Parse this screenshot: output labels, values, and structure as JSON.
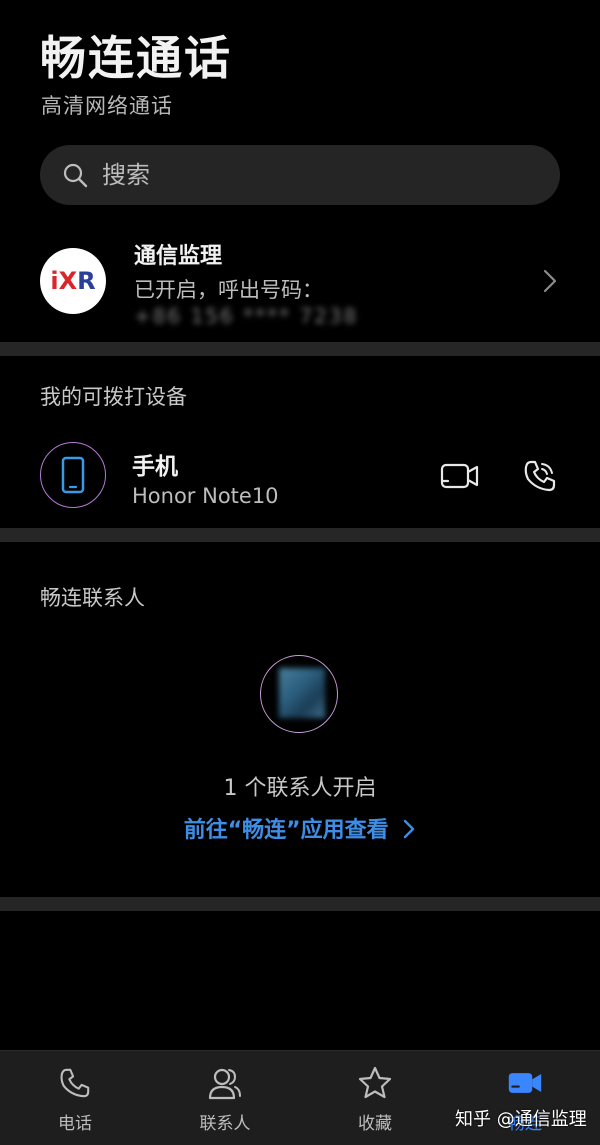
{
  "header": {
    "title": "畅连通话",
    "subtitle": "高清网络通话"
  },
  "search": {
    "placeholder": "搜索"
  },
  "account": {
    "logo_text": "iXR",
    "name": "通信监理",
    "status": "已开启，呼出号码：",
    "number_masked": "+86 156 **** 7238"
  },
  "devices_section": {
    "title": "我的可拨打设备",
    "items": [
      {
        "name": "手机",
        "model": "Honor Note10"
      }
    ]
  },
  "contacts_section": {
    "title": "畅连联系人",
    "count_text": "1 个联系人开启",
    "link_text": "前往“畅连”应用查看"
  },
  "tabbar": {
    "items": [
      {
        "label": "电话",
        "icon": "phone-icon"
      },
      {
        "label": "联系人",
        "icon": "contacts-icon"
      },
      {
        "label": "收藏",
        "icon": "star-icon"
      },
      {
        "label": "畅连",
        "icon": "video-call-icon"
      }
    ],
    "active_index": 3
  },
  "watermark": {
    "text": "知乎 @通信监理"
  },
  "colors": {
    "background": "#000000",
    "surface": "#252525",
    "divider": "#262626",
    "accent": "#3a86ff",
    "link": "#3f8ee6",
    "avatar_ring": "#b57ad8"
  }
}
